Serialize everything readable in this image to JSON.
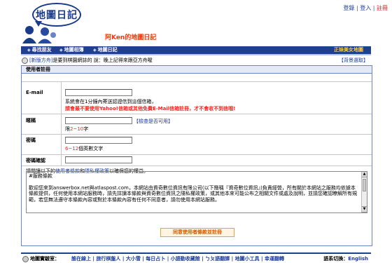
{
  "logo": {
    "text": "地圖日記"
  },
  "top_links": {
    "login": "登錄",
    "register": "登入",
    "home": "註冊"
  },
  "site_title": "阿Ken的地圖日記",
  "nav": {
    "items": [
      "尋找朋友",
      "地圖相簿",
      "地圖日記"
    ],
    "right": "正妹美女地圖"
  },
  "announce": {
    "prefix": "[新版方舟]",
    "text": "是要到棋園網誌的 說：晚上記得來跟亞方舟喔",
    "right": "【背景選取】"
  },
  "panel": {
    "header": "使用者註冊",
    "email": {
      "label": "E-mail",
      "value": "",
      "note1": "系統會在1分鐘內寄送認證信到這個信箱，",
      "note2": "請會最不要使用Yahoo!信箱或其他免費E-Mail信箱註冊，才不會收不到信哦!"
    },
    "nickname": {
      "label": "暱稱",
      "value": "",
      "check": "【檢查是否可用】",
      "limit_prefix": "限",
      "limit_range": "2~10",
      "limit_suffix": "字"
    },
    "password": {
      "label": "密碼",
      "value": "",
      "hint_range": "6~12",
      "hint_text": "個英數文字"
    },
    "confirm": {
      "label": "密碼確認",
      "value": ""
    },
    "terms_intro_1": "請閱讀以下的",
    "terms_link1": "使用者條款",
    "terms_and": "和",
    "terms_link2": "隱私權政策",
    "terms_intro_2": "以確保您的權益。",
    "terms_text": "#服務條款\n\n歡迎您來到answerbox.net與atlaspost.com，本網站由資奇數位資訊有限公司(以下簡稱『資奇數位資訊』)負責經營，所有關於本網站之服務均依據本條款提供，任何使用本網站服務時，請先詳讀本條款與資奇數位資訊之隱私權政策，或其他本來可能公布之相關文件或處及說明，並請您確認瞭解所有規範，若您無法遵守本條款內容或對於本條款內容有任何不同意者，請勿使用本網站服務。",
    "agree_button": "同意使用者條款並註冊"
  },
  "footer": {
    "label": "地圖實驗室：",
    "links": "誰在線上 | 旅行棋盤人 | 大小雪 | 每日占卜 | 小語動收藏館 | ㄅㄆ語翻譯 | 地圖小工具 | 幸運翻轉",
    "lang_label": "語系切換：",
    "lang": "English"
  }
}
